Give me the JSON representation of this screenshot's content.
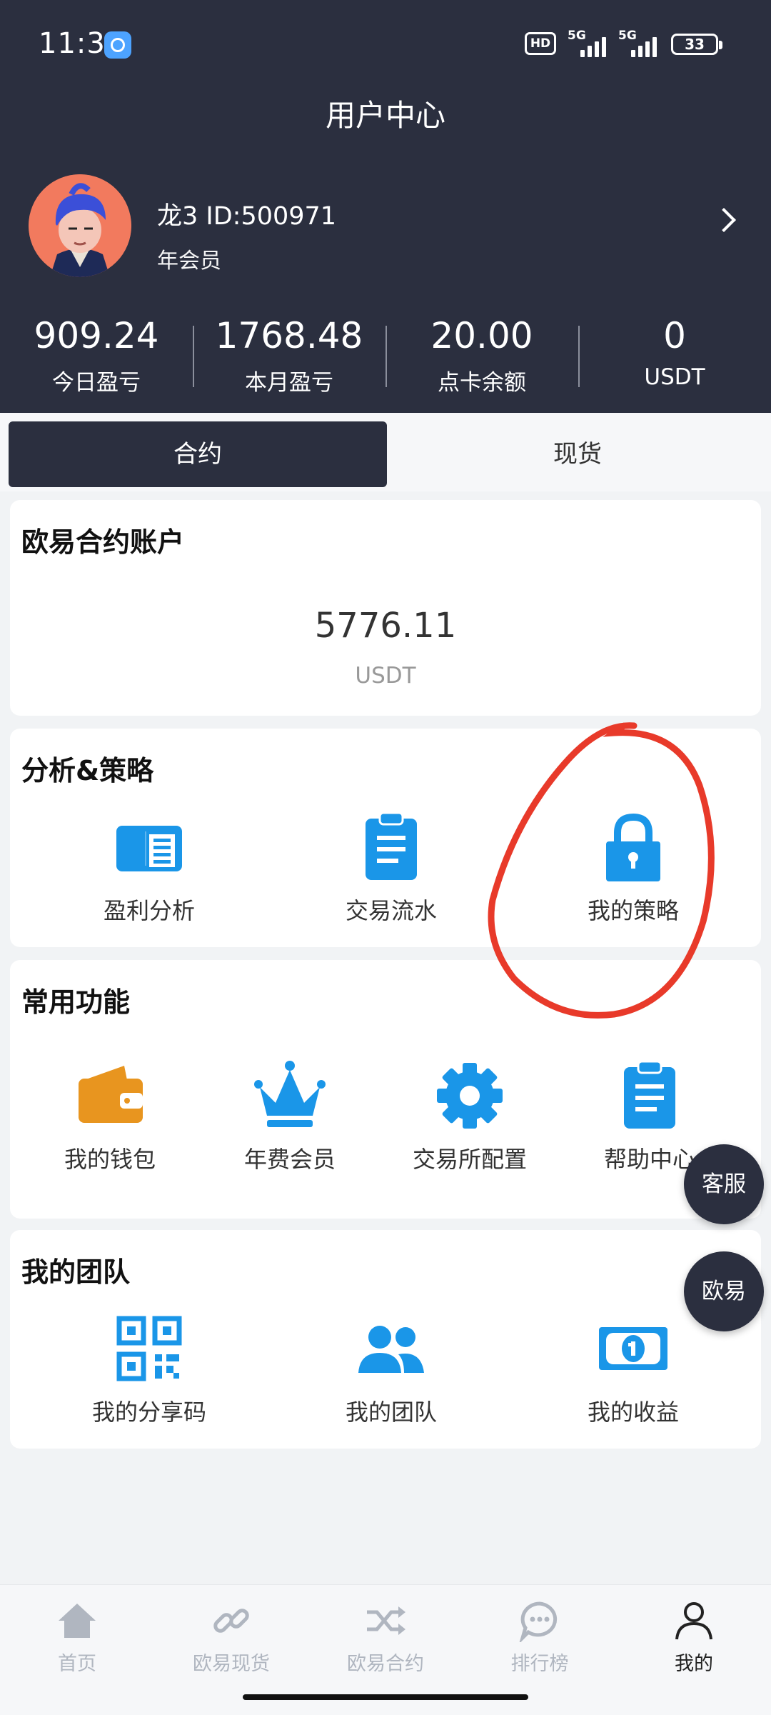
{
  "status_bar": {
    "time": "11:36",
    "network_1": "5G",
    "network_2": "5G",
    "hd_label": "HD",
    "battery": "33"
  },
  "header": {
    "title": "用户中心",
    "user_name": "龙3 ID:500971",
    "user_level": "年会员",
    "stats": [
      {
        "value": "909.24",
        "label": "今日盈亏"
      },
      {
        "value": "1768.48",
        "label": "本月盈亏"
      },
      {
        "value": "20.00",
        "label": "点卡余额"
      },
      {
        "value": "0",
        "label": "USDT"
      }
    ]
  },
  "tabs": [
    {
      "label": "合约",
      "active": true
    },
    {
      "label": "现货",
      "active": false
    }
  ],
  "account_card": {
    "title": "欧易合约账户",
    "balance": "5776.11",
    "unit": "USDT"
  },
  "analysis_card": {
    "title": "分析&策略",
    "items": [
      {
        "label": "盈利分析",
        "icon": "newspaper-icon"
      },
      {
        "label": "交易流水",
        "icon": "clipboard-icon"
      },
      {
        "label": "我的策略",
        "icon": "lock-icon"
      }
    ]
  },
  "functions_card": {
    "title": "常用功能",
    "items": [
      {
        "label": "我的钱包",
        "icon": "wallet-icon"
      },
      {
        "label": "年费会员",
        "icon": "crown-icon"
      },
      {
        "label": "交易所配置",
        "icon": "gear-icon"
      },
      {
        "label": "帮助中心",
        "icon": "clipboard-icon"
      }
    ]
  },
  "team_card": {
    "title": "我的团队",
    "items": [
      {
        "label": "我的分享码",
        "icon": "qr-code-icon"
      },
      {
        "label": "我的团队",
        "icon": "users-icon"
      },
      {
        "label": "我的收益",
        "icon": "money-icon"
      }
    ]
  },
  "floating": {
    "service": "客服",
    "okx": "欧易"
  },
  "bottom_nav": [
    {
      "label": "首页",
      "icon": "home-icon",
      "active": false
    },
    {
      "label": "欧易现货",
      "icon": "link-icon",
      "active": false
    },
    {
      "label": "欧易合约",
      "icon": "shuffle-icon",
      "active": false
    },
    {
      "label": "排行榜",
      "icon": "chat-icon",
      "active": false
    },
    {
      "label": "我的",
      "icon": "user-icon",
      "active": true
    }
  ],
  "colors": {
    "header_bg": "#2b2f3f",
    "icon_blue": "#1a96e8",
    "wallet_orange": "#e8951f",
    "annotation_red": "#e83a2a"
  }
}
